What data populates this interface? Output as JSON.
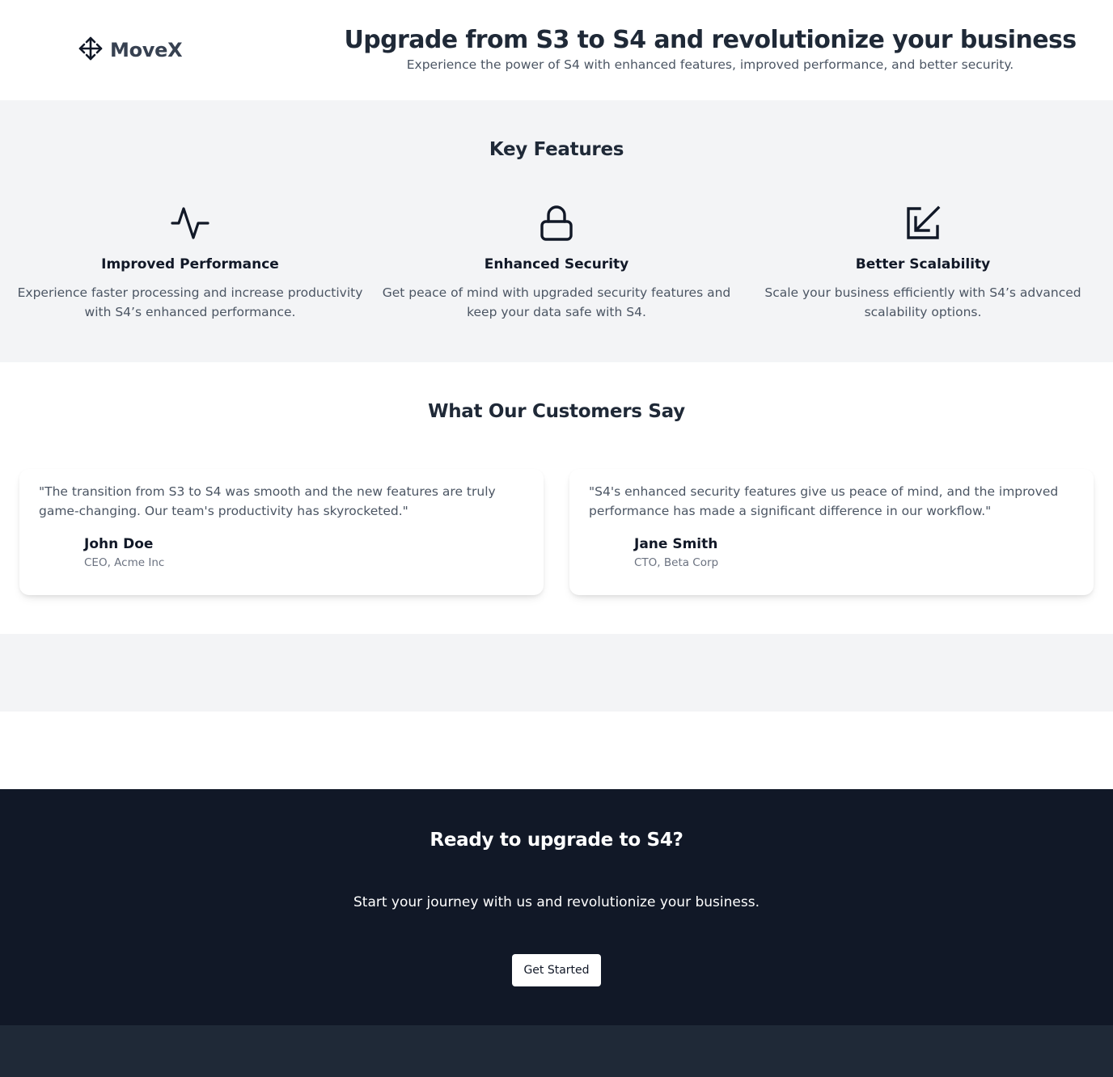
{
  "header": {
    "logo_icon": "move-arrows-icon",
    "logo_text": "MoveX",
    "title": "Upgrade from S3 to S4 and revolutionize your business",
    "subtitle": "Experience the power of S4 with enhanced features, improved performance, and better security."
  },
  "features": {
    "title": "Key Features",
    "items": [
      {
        "icon": "activity-pulse-icon",
        "title": "Improved Performance",
        "description": "Experience faster processing and increase productivity with S4’s enhanced performance."
      },
      {
        "icon": "lock-icon",
        "title": "Enhanced Security",
        "description": "Get peace of mind with upgraded security features and keep your data safe with S4."
      },
      {
        "icon": "arrow-down-left-box-icon",
        "title": "Better Scalability",
        "description": "Scale your business efficiently with S4’s advanced scalability options."
      }
    ]
  },
  "testimonials": {
    "title": "What Our Customers Say",
    "items": [
      {
        "quote": "\"The transition from S3 to S4 was smooth and the new features are truly game-changing. Our team's productivity has skyrocketed.\"",
        "name": "John Doe",
        "role": "CEO, Acme Inc"
      },
      {
        "quote": "\"S4's enhanced security features give us peace of mind, and the improved performance has made a significant difference in our workflow.\"",
        "name": "Jane Smith",
        "role": "CTO, Beta Corp"
      }
    ]
  },
  "cta": {
    "title": "Ready to upgrade to S4?",
    "subtitle": "Start your journey with us and revolutionize your business.",
    "button_label": "Get Started"
  },
  "colors": {
    "dark_bg": "#111827",
    "footer_bg": "#1f2937",
    "light_bg": "#f3f4f6",
    "text_primary": "#1f2937",
    "text_secondary": "#4b5563"
  }
}
